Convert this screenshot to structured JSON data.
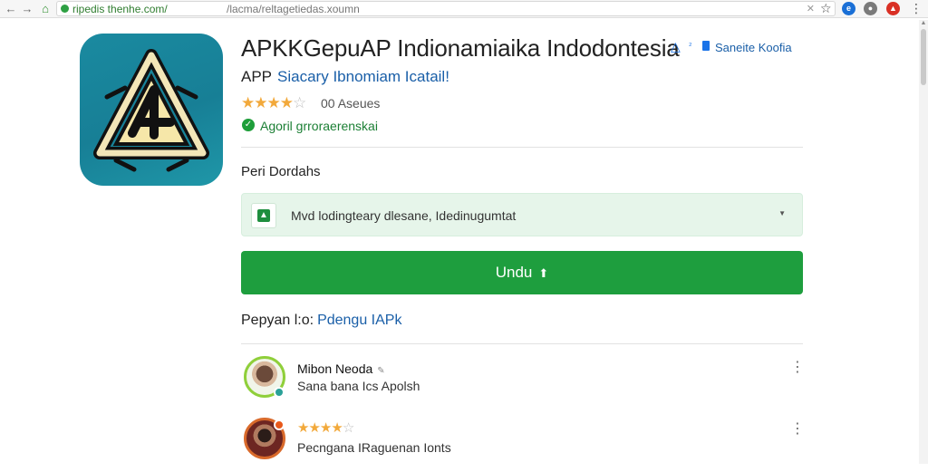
{
  "browser": {
    "back_icon": "back-arrow-icon",
    "forward_icon": "forward-arrow-icon",
    "home_icon": "home-icon",
    "url_host": "ripedis thenhe.com/",
    "url_path": "/lacma/reltagetiedas.xoumn",
    "bookmark_icon": "star-icon",
    "extension_colors": [
      "#1a6fd6",
      "#7a7a7a",
      "#d93025"
    ]
  },
  "app": {
    "title": "APKKGepuAP Indionamiaika Indodontesia",
    "title_sup": "₂",
    "title_link": "Saneite Koofia",
    "subtitle_prefix": "APP",
    "subtitle_link": "Siacary Ibnomiam Icatail!",
    "rating_stars": 4,
    "rating_max": 5,
    "rating_count": "00 Aseues",
    "verified_text": "Agoril grroraerenskai",
    "accent_color": "#1e9e3e",
    "icon_bg_color": "#1a8aa0"
  },
  "details": {
    "section_label": "Peri Dordahs",
    "option_text": "Mvd lodingteary dlesane, Idedinugumtat",
    "download_label": "Undu"
  },
  "related": {
    "prefix": "Pepyan l:o:",
    "link": "Pdengu IAPk"
  },
  "reviews": [
    {
      "name": "Mibon Neoda",
      "text": "Sana bana Ics Apolsh",
      "badge_color": "#2aa198"
    },
    {
      "stars": 4,
      "text": "Pecngana IRaguenan Ionts",
      "badge_color": "#e8591a"
    }
  ]
}
